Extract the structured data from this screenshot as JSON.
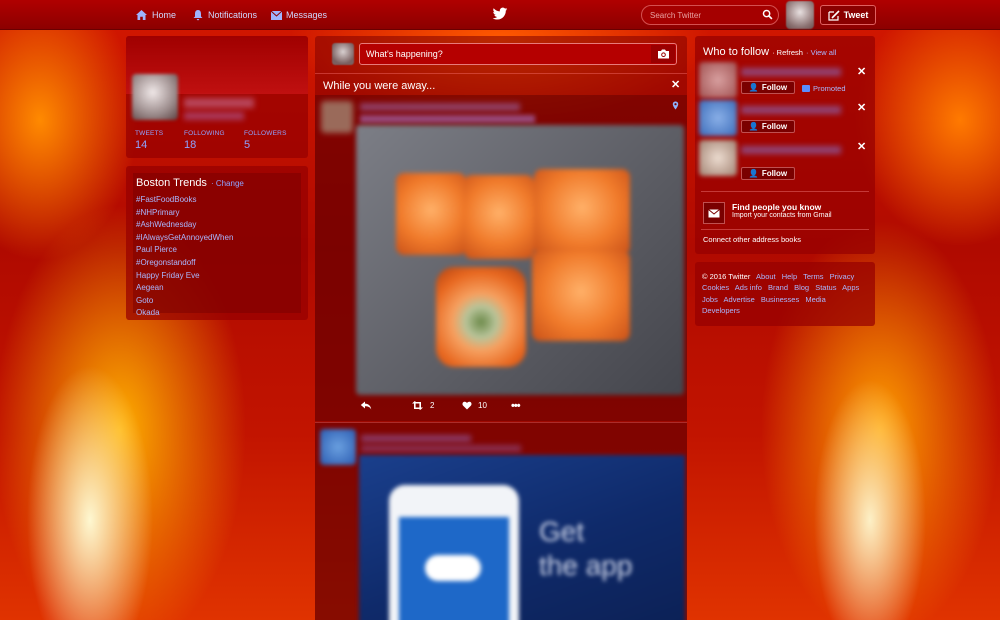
{
  "nav": {
    "home": "Home",
    "notifications": "Notifications",
    "messages": "Messages",
    "search_placeholder": "Search Twitter",
    "tweet_button": "Tweet"
  },
  "profile": {
    "stats": [
      {
        "label": "TWEETS",
        "value": "14"
      },
      {
        "label": "FOLLOWING",
        "value": "18"
      },
      {
        "label": "FOLLOWERS",
        "value": "5"
      }
    ]
  },
  "trends": {
    "title": "Boston Trends",
    "change": "· Change",
    "items": [
      "#FastFoodBooks",
      "#NHPrimary",
      "#AshWednesday",
      "#IAlwaysGetAnnoyedWhen",
      "Paul Pierce",
      "#Oregonstandoff",
      "Happy Friday Eve",
      "Aegean",
      "Goto",
      "Okada"
    ]
  },
  "compose": {
    "placeholder": "What's happening?"
  },
  "timeline": {
    "away_title": "While you were away...",
    "tweet1": {
      "retweets": "2",
      "likes": "10"
    },
    "tweet2": {
      "ad_text_1": "Get",
      "ad_text_2": "the app"
    }
  },
  "who_to_follow": {
    "title": "Who to follow",
    "refresh": "· Refresh",
    "view_all": "· View all",
    "follow_label": "Follow",
    "promoted": "Promoted",
    "find_title": "Find people you know",
    "find_sub": "Import your contacts from Gmail",
    "connect": "Connect other address books"
  },
  "footer": {
    "copyright": "© 2016 Twitter",
    "links": [
      "About",
      "Help",
      "Terms",
      "Privacy",
      "Cookies",
      "Ads info",
      "Brand",
      "Blog",
      "Status",
      "Apps",
      "Jobs",
      "Advertise",
      "Businesses",
      "Media",
      "Developers"
    ]
  },
  "icons": {
    "home": "home-icon",
    "notifications": "bell-icon",
    "messages": "envelope-icon",
    "logo": "twitter-bird-icon",
    "search": "search-icon",
    "compose_tweet": "quill-icon",
    "camera": "camera-icon",
    "close": "close-icon",
    "location": "location-pin-icon",
    "reply": "reply-icon",
    "retweet": "retweet-icon",
    "like": "heart-icon",
    "more": "more-icon",
    "follow": "add-user-icon",
    "mail": "mail-icon"
  },
  "colors": {
    "link": "#a9b8ff",
    "topbar": "#a00000",
    "panel": "#960000"
  }
}
